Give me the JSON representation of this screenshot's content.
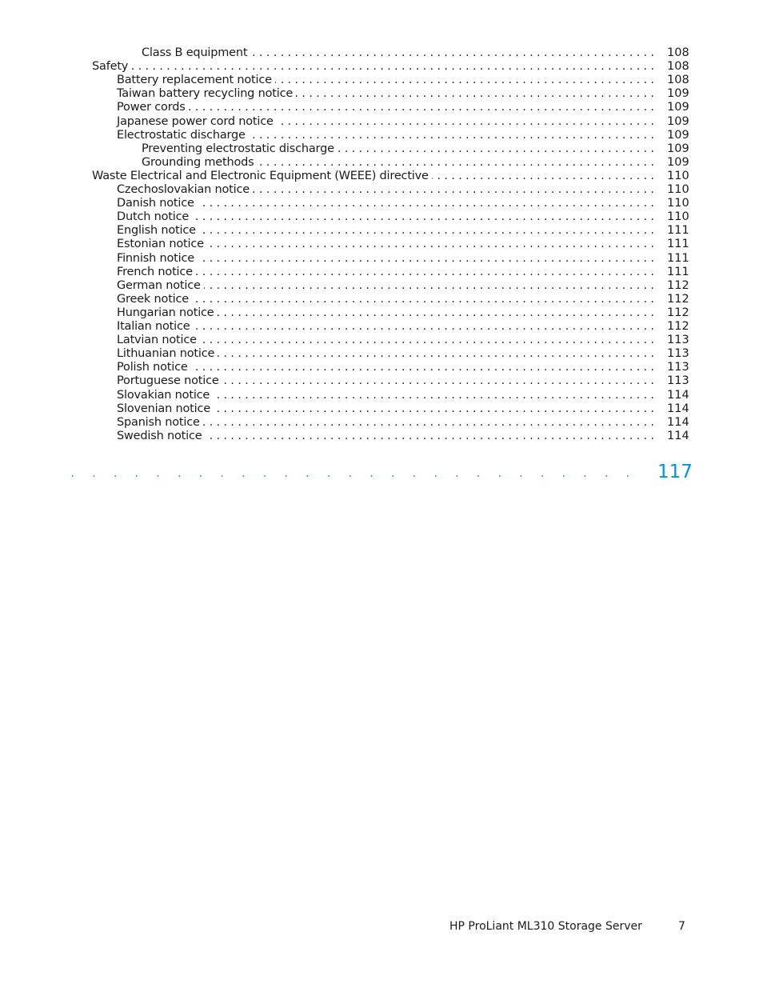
{
  "toc": {
    "entries": [
      {
        "level": 2,
        "label": "Class B equipment",
        "page": "108"
      },
      {
        "level": 0,
        "label": "Safety",
        "page": "108"
      },
      {
        "level": 1,
        "label": "Battery replacement notice",
        "page": "108"
      },
      {
        "level": 1,
        "label": "Taiwan battery recycling notice",
        "page": "109"
      },
      {
        "level": 1,
        "label": "Power cords",
        "page": "109"
      },
      {
        "level": 1,
        "label": "Japanese power cord notice",
        "page": "109"
      },
      {
        "level": 1,
        "label": "Electrostatic discharge",
        "page": "109"
      },
      {
        "level": 2,
        "label": "Preventing electrostatic discharge",
        "page": "109"
      },
      {
        "level": 2,
        "label": "Grounding methods",
        "page": "109"
      },
      {
        "level": 0,
        "label": "Waste Electrical and Electronic Equipment (WEEE) directive",
        "page": "110"
      },
      {
        "level": 1,
        "label": "Czechoslovakian notice",
        "page": "110"
      },
      {
        "level": 1,
        "label": "Danish notice",
        "page": "110"
      },
      {
        "level": 1,
        "label": "Dutch notice",
        "page": "110"
      },
      {
        "level": 1,
        "label": "English notice",
        "page": "111"
      },
      {
        "level": 1,
        "label": "Estonian notice",
        "page": "111"
      },
      {
        "level": 1,
        "label": "Finnish notice",
        "page": "111"
      },
      {
        "level": 1,
        "label": "French notice",
        "page": "111"
      },
      {
        "level": 1,
        "label": "German notice",
        "page": "112"
      },
      {
        "level": 1,
        "label": "Greek notice",
        "page": "112"
      },
      {
        "level": 1,
        "label": "Hungarian notice",
        "page": "112"
      },
      {
        "level": 1,
        "label": "Italian notice",
        "page": "112"
      },
      {
        "level": 1,
        "label": "Latvian notice",
        "page": "113"
      },
      {
        "level": 1,
        "label": "Lithuanian notice",
        "page": "113"
      },
      {
        "level": 1,
        "label": "Polish notice",
        "page": "113"
      },
      {
        "level": 1,
        "label": "Portuguese notice",
        "page": "113"
      },
      {
        "level": 1,
        "label": "Slovakian notice",
        "page": "114"
      },
      {
        "level": 1,
        "label": "Slovenian notice",
        "page": "114"
      },
      {
        "level": 1,
        "label": "Spanish notice",
        "page": "114"
      },
      {
        "level": 1,
        "label": "Swedish notice",
        "page": "114"
      }
    ],
    "index_entry": {
      "label": "",
      "page": "117",
      "color": "#0096d6"
    }
  },
  "footer": {
    "title": "HP ProLiant ML310 Storage Server",
    "page_number": "7"
  }
}
